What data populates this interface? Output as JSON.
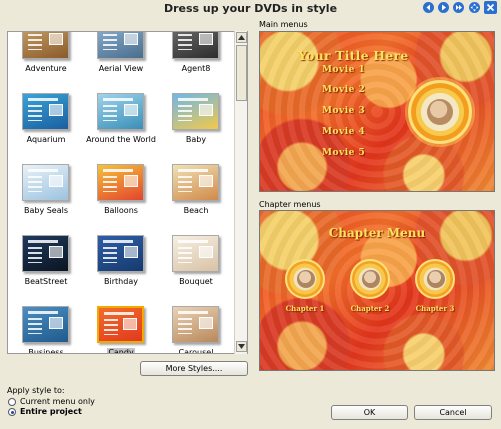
{
  "window": {
    "title": "Dress up your DVDs in style",
    "buttons": [
      "back-icon",
      "play-icon",
      "forward-icon",
      "move-icon",
      "close-icon"
    ]
  },
  "styles": {
    "items": [
      {
        "label": "Adventure",
        "colors": [
          "#c9a46a",
          "#8b5a2b"
        ]
      },
      {
        "label": "Aerial View",
        "colors": [
          "#8fb3d4",
          "#4a6d8c"
        ]
      },
      {
        "label": "Agent8",
        "colors": [
          "#707070",
          "#2d2d2d"
        ]
      },
      {
        "label": "Aquarium",
        "colors": [
          "#3aa3d8",
          "#1a5fa0"
        ]
      },
      {
        "label": "Around the World",
        "colors": [
          "#9fd3ea",
          "#3a8fb8"
        ]
      },
      {
        "label": "Baby",
        "colors": [
          "#6fb7e6",
          "#f2c94c"
        ]
      },
      {
        "label": "Baby Seals",
        "colors": [
          "#e9f1f8",
          "#9cc3e0"
        ]
      },
      {
        "label": "Balloons",
        "colors": [
          "#f6c23a",
          "#e2452e"
        ]
      },
      {
        "label": "Beach",
        "colors": [
          "#f1e1b5",
          "#d08a4a"
        ]
      },
      {
        "label": "BeatStreet",
        "colors": [
          "#1f3a5e",
          "#0b1522"
        ]
      },
      {
        "label": "Birthday",
        "colors": [
          "#2f5ea8",
          "#163a6e"
        ]
      },
      {
        "label": "Bouquet",
        "colors": [
          "#f6efe4",
          "#d9c2a4"
        ]
      },
      {
        "label": "Business",
        "colors": [
          "#4c8fc4",
          "#1f5a8c"
        ]
      },
      {
        "label": "Candy",
        "colors": [
          "#f26d2a",
          "#e03a1f"
        ]
      },
      {
        "label": "Carousel",
        "colors": [
          "#e9d2b6",
          "#b8895a"
        ]
      }
    ],
    "selected": "Candy"
  },
  "buttons": {
    "more_styles": "More Styles....",
    "ok": "OK",
    "cancel": "Cancel"
  },
  "preview": {
    "main_menus_label": "Main menus",
    "main_title": "Your Title Here",
    "movies": [
      "Movie 1",
      "Movie 2",
      "Movie 3",
      "Movie 4",
      "Movie 5"
    ],
    "chapter_menus_label": "Chapter menus",
    "chapter_title": "Chapter Menu",
    "chapters": [
      "Chapter 1",
      "Chapter 2",
      "Chapter 3"
    ]
  },
  "apply": {
    "label": "Apply style to:",
    "options": [
      "Current menu only",
      "Entire project"
    ],
    "selected": "Entire project"
  },
  "colors": {
    "accent": "#1a4d9e",
    "selection_border": "#f2a900"
  }
}
